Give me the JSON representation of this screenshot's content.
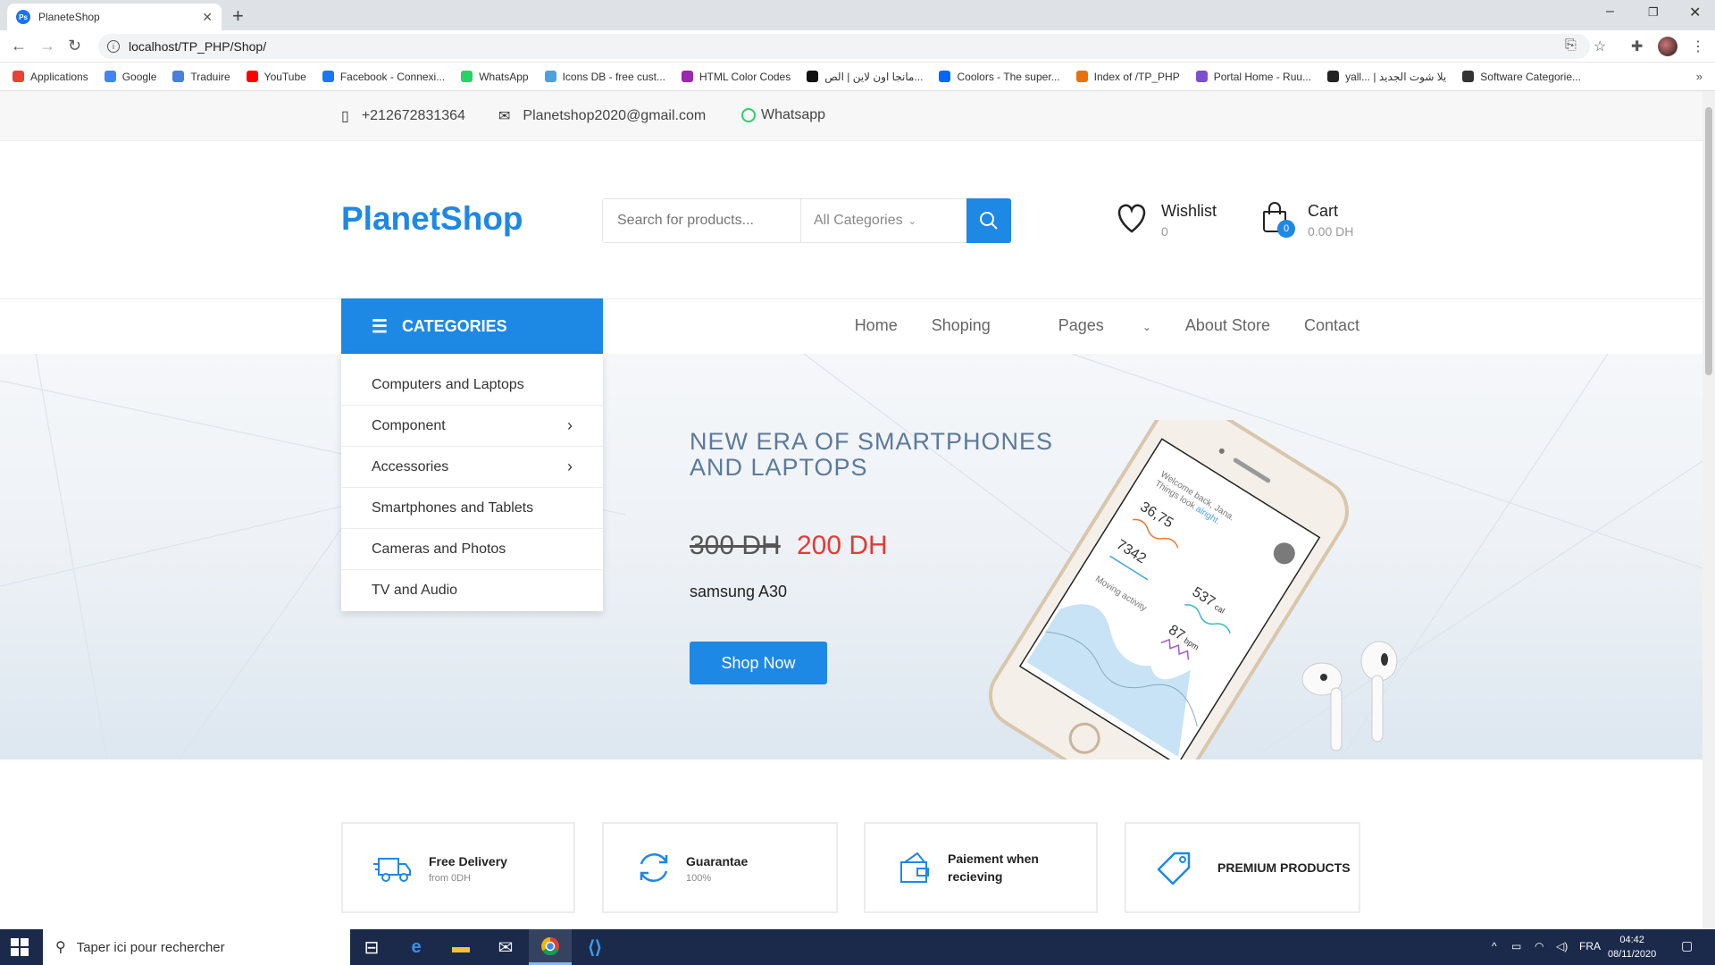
{
  "browser": {
    "tab_title": "PlaneteShop",
    "tab_favicon": "Ps",
    "url": "localhost/TP_PHP/Shop/",
    "bookmarks": [
      {
        "label": "Applications",
        "color": "#e94235"
      },
      {
        "label": "Google",
        "color": "#4285f4"
      },
      {
        "label": "Traduire",
        "color": "#4a7fe0"
      },
      {
        "label": "YouTube",
        "color": "#ff0000"
      },
      {
        "label": "Facebook - Connexi...",
        "color": "#1877f2"
      },
      {
        "label": "WhatsApp",
        "color": "#25d366"
      },
      {
        "label": "Icons DB - free cust...",
        "color": "#4aa3df"
      },
      {
        "label": "HTML Color Codes",
        "color": "#9c27b0"
      },
      {
        "label": "مانجا اون لاين | الص...",
        "color": "#111111"
      },
      {
        "label": "Coolors - The super...",
        "color": "#0066ff"
      },
      {
        "label": "Index of /TP_PHP",
        "color": "#e8710a"
      },
      {
        "label": "Portal Home - Ruu...",
        "color": "#7b4fd0"
      },
      {
        "label": "yall... | يلا شوت الجديد",
        "color": "#222222"
      },
      {
        "label": "Software Categorie...",
        "color": "#333333"
      }
    ]
  },
  "contact": {
    "phone": "+212672831364",
    "email": "Planetshop2020@gmail.com",
    "whatsapp": "Whatsapp"
  },
  "header": {
    "logo": "PlanetShop",
    "search_placeholder": "Search for products...",
    "category_select": "All Categories",
    "wishlist_label": "Wishlist",
    "wishlist_count": "0",
    "cart_label": "Cart",
    "cart_total": "0.00 DH",
    "cart_badge": "0"
  },
  "nav": {
    "categories_label": "CATEGORIES",
    "links": [
      "Home",
      "Shoping",
      "Pages",
      "About Store",
      "Contact"
    ]
  },
  "categories": [
    {
      "label": "Computers and Laptops",
      "has_submenu": false
    },
    {
      "label": "Component",
      "has_submenu": true
    },
    {
      "label": "Accessories",
      "has_submenu": true
    },
    {
      "label": "Smartphones and Tablets",
      "has_submenu": false
    },
    {
      "label": "Cameras and Photos",
      "has_submenu": false
    },
    {
      "label": "TV and Audio",
      "has_submenu": false
    }
  ],
  "hero": {
    "title": "NEW ERA OF SMARTPHONES AND LAPTOPS",
    "old_price": "300 DH",
    "new_price": "200 DH",
    "product": "samsung A30",
    "cta": "Shop Now",
    "screen": {
      "greeting": "Welcome back, Jana.",
      "greeting2": "Things look ",
      "greeting_accent": "alright.",
      "stat1": "36,75",
      "stat2": "7342",
      "stat3": "537",
      "stat3_unit": "cal",
      "stat4": "87",
      "stat4_unit": "bpm",
      "chart_label": "Moving activity"
    }
  },
  "features": [
    {
      "title": "Free Delivery",
      "subtitle": "from 0DH",
      "icon": "truck-icon"
    },
    {
      "title": "Guarantae",
      "subtitle": "100%",
      "icon": "refresh-icon"
    },
    {
      "title": "Paiement when recieving",
      "subtitle": "",
      "icon": "wallet-icon"
    },
    {
      "title": "PREMIUM PRODUCTS",
      "subtitle": "",
      "icon": "tag-icon"
    }
  ],
  "taskbar": {
    "search_placeholder": "Taper ici pour rechercher",
    "language": "FRA",
    "time": "04:42",
    "date": "08/11/2020"
  },
  "colors": {
    "brand": "#1e88e5",
    "sale_price": "#e53935",
    "hero_title": "#5b7a9a"
  }
}
